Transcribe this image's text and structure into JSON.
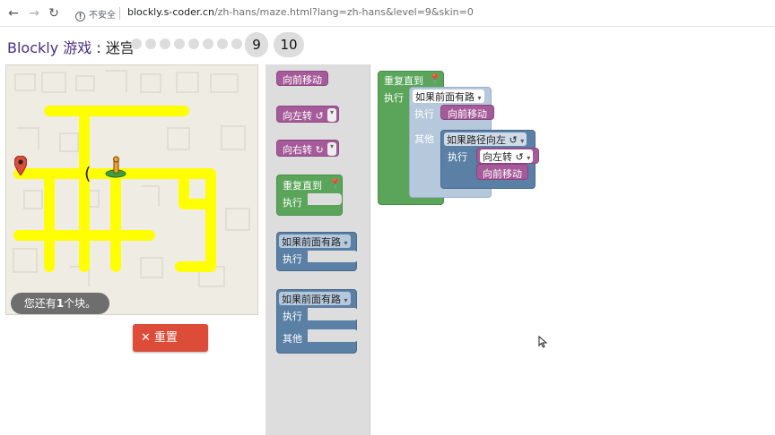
{
  "browser": {
    "back_icon": "arrow-left-icon",
    "forward_icon": "arrow-right-icon",
    "reload_icon": "reload-icon",
    "security_label": "不安全",
    "url_host": "blockly.s-coder.cn",
    "url_path": "/zh-hans/maze.html?lang=zh-hans&level=9&skin=0"
  },
  "header": {
    "app_name": "Blockly 游戏",
    "separator": " : ",
    "game_name": "迷宫",
    "levels": [
      "1",
      "2",
      "3",
      "4",
      "5",
      "6",
      "7",
      "8",
      "9",
      "10"
    ],
    "current_level": "9",
    "shown_levels": [
      "9",
      "10"
    ]
  },
  "maze": {
    "remaining_blocks_text": "您还有1个块。",
    "remaining_prefix": "您还有",
    "remaining_count": "1",
    "remaining_suffix": "个块。",
    "path_color": "#ffff00",
    "start_icon": "pegman-icon",
    "goal_icon": "map-pin-icon"
  },
  "controls": {
    "reset_label": "重置",
    "reset_color": "#dd4b39"
  },
  "toolbox": {
    "move_forward": "向前移动",
    "turn_left": "向左转 ↺",
    "turn_right": "向右转 ↻",
    "repeat_until": "重复直到",
    "do": "执行",
    "if_path_ahead": "如果前面有路",
    "if_path_ahead_2": "如果前面有路",
    "do_2": "执行",
    "do_3": "执行",
    "else": "其他"
  },
  "workspace": {
    "repeat_until": "重复直到",
    "do": "执行",
    "if_path_ahead": "如果前面有路",
    "if_do": "执行",
    "move_forward_1": "向前移动",
    "else": "其他",
    "if_path_left": "如果路径向左 ↺",
    "inner_do": "执行",
    "turn_left": "向左转 ↺",
    "move_forward_2": "向前移动"
  },
  "colors": {
    "motion": "#a55b99",
    "loop": "#5ba55b",
    "logic": "#5b80a5"
  }
}
